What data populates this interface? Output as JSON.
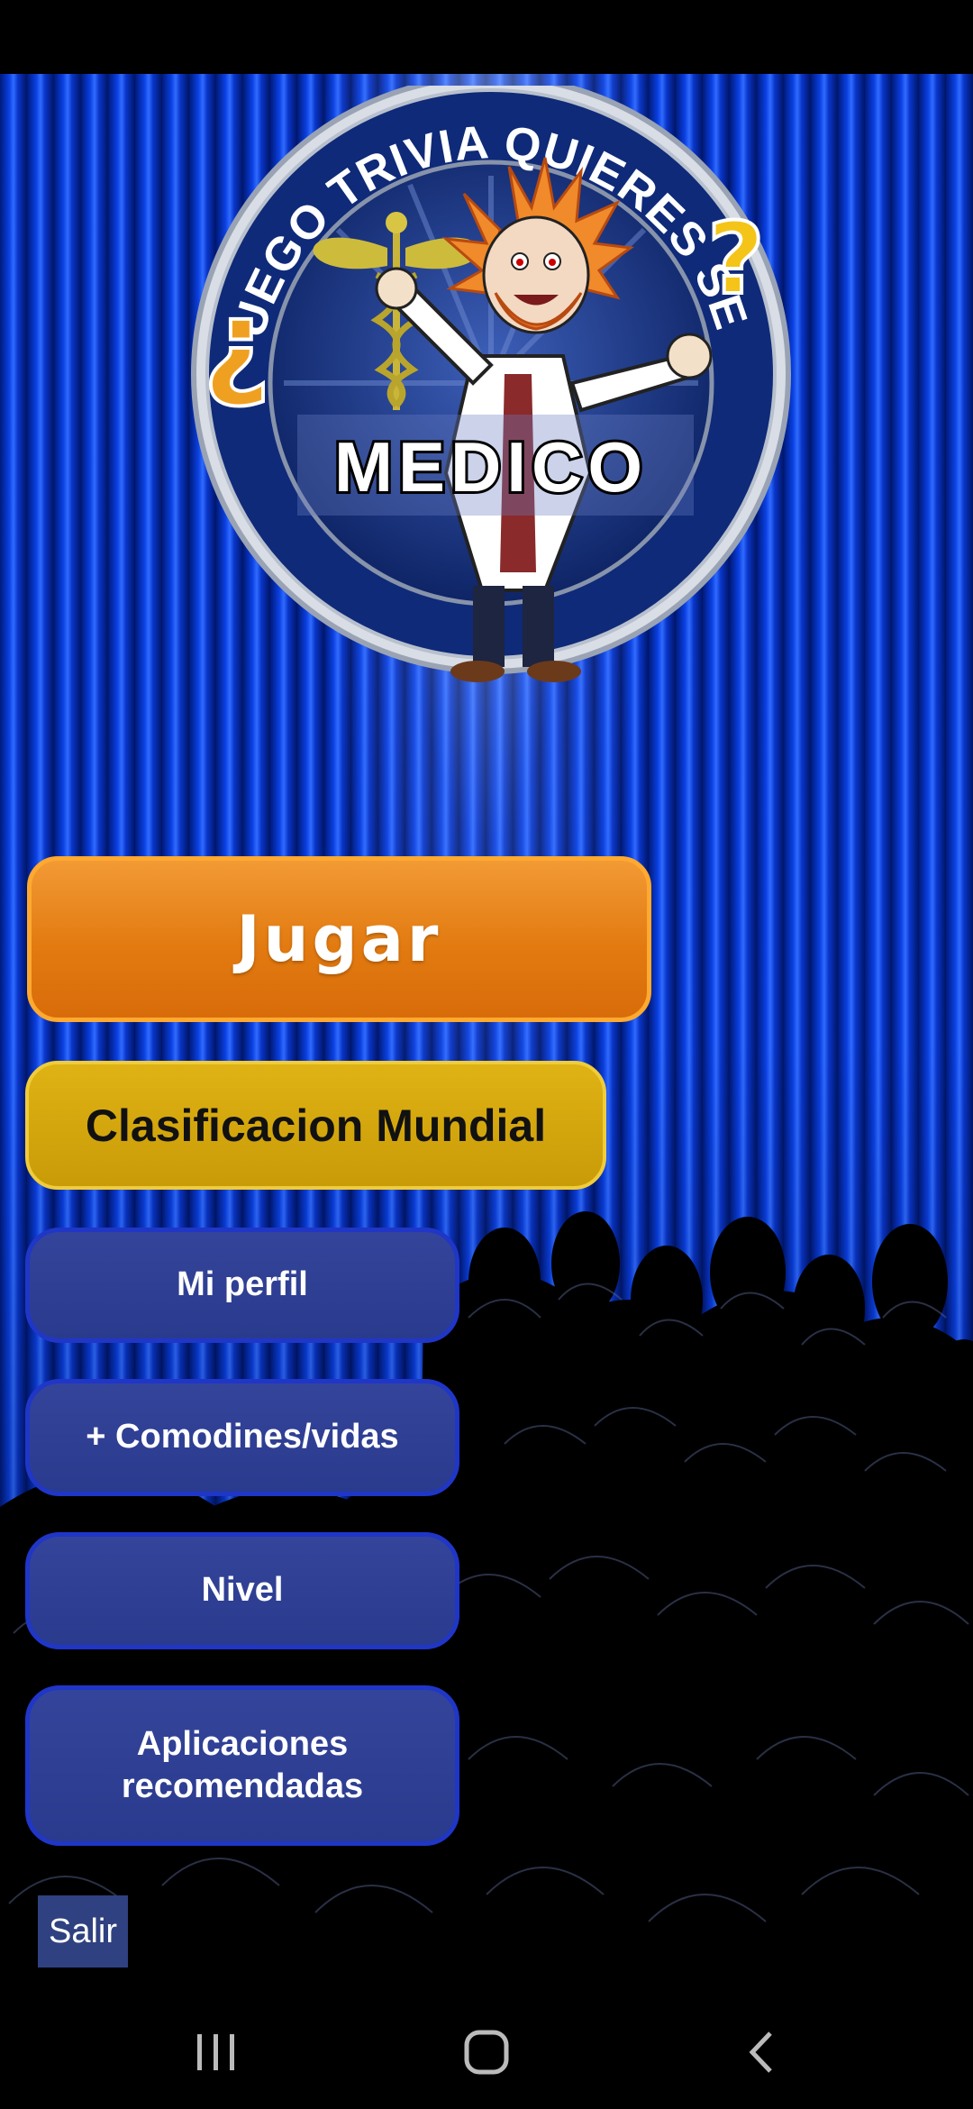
{
  "logo": {
    "arc_text": "JUEGO TRIVIA QUIERES SER",
    "title": "MEDICO",
    "question_open": "¿",
    "question_close": "?"
  },
  "menu": {
    "play": "Jugar",
    "ranking": "Clasificacion Mundial",
    "profile": "Mi perfil",
    "wildcards": "+ Comodines/vidas",
    "level": "Nivel",
    "apps_line1": "Aplicaciones",
    "apps_line2": "recomendadas",
    "exit": "Salir"
  },
  "colors": {
    "play": "#e27a10",
    "ranking": "#c99b08",
    "menu_blue": "#2a3b8e",
    "curtain": "#0a3fe0"
  }
}
